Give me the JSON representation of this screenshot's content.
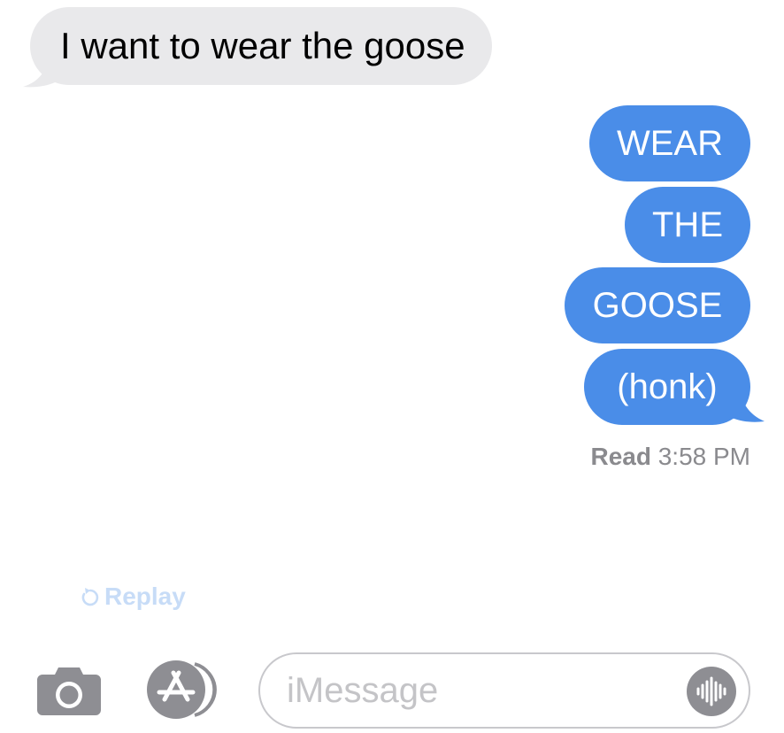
{
  "conversation": {
    "incoming": [
      {
        "text": "I want to wear the goose"
      }
    ],
    "outgoing": [
      {
        "text": "WEAR"
      },
      {
        "text": "THE"
      },
      {
        "text": "GOOSE"
      },
      {
        "text": "(honk)"
      }
    ],
    "read_receipt": {
      "label": "Read",
      "time": "3:58 PM"
    },
    "replay_label": "Replay"
  },
  "composer": {
    "placeholder": "iMessage",
    "icons": {
      "camera": "camera-icon",
      "apps": "app-store-icon",
      "audio": "waveform-icon"
    }
  },
  "colors": {
    "incoming_bubble": "#e9e9eb",
    "outgoing_bubble": "#4a8de8",
    "receipt_text": "#8a8a8e",
    "replay_text": "#c7dcf7",
    "icon_gray": "#8e8e93"
  }
}
